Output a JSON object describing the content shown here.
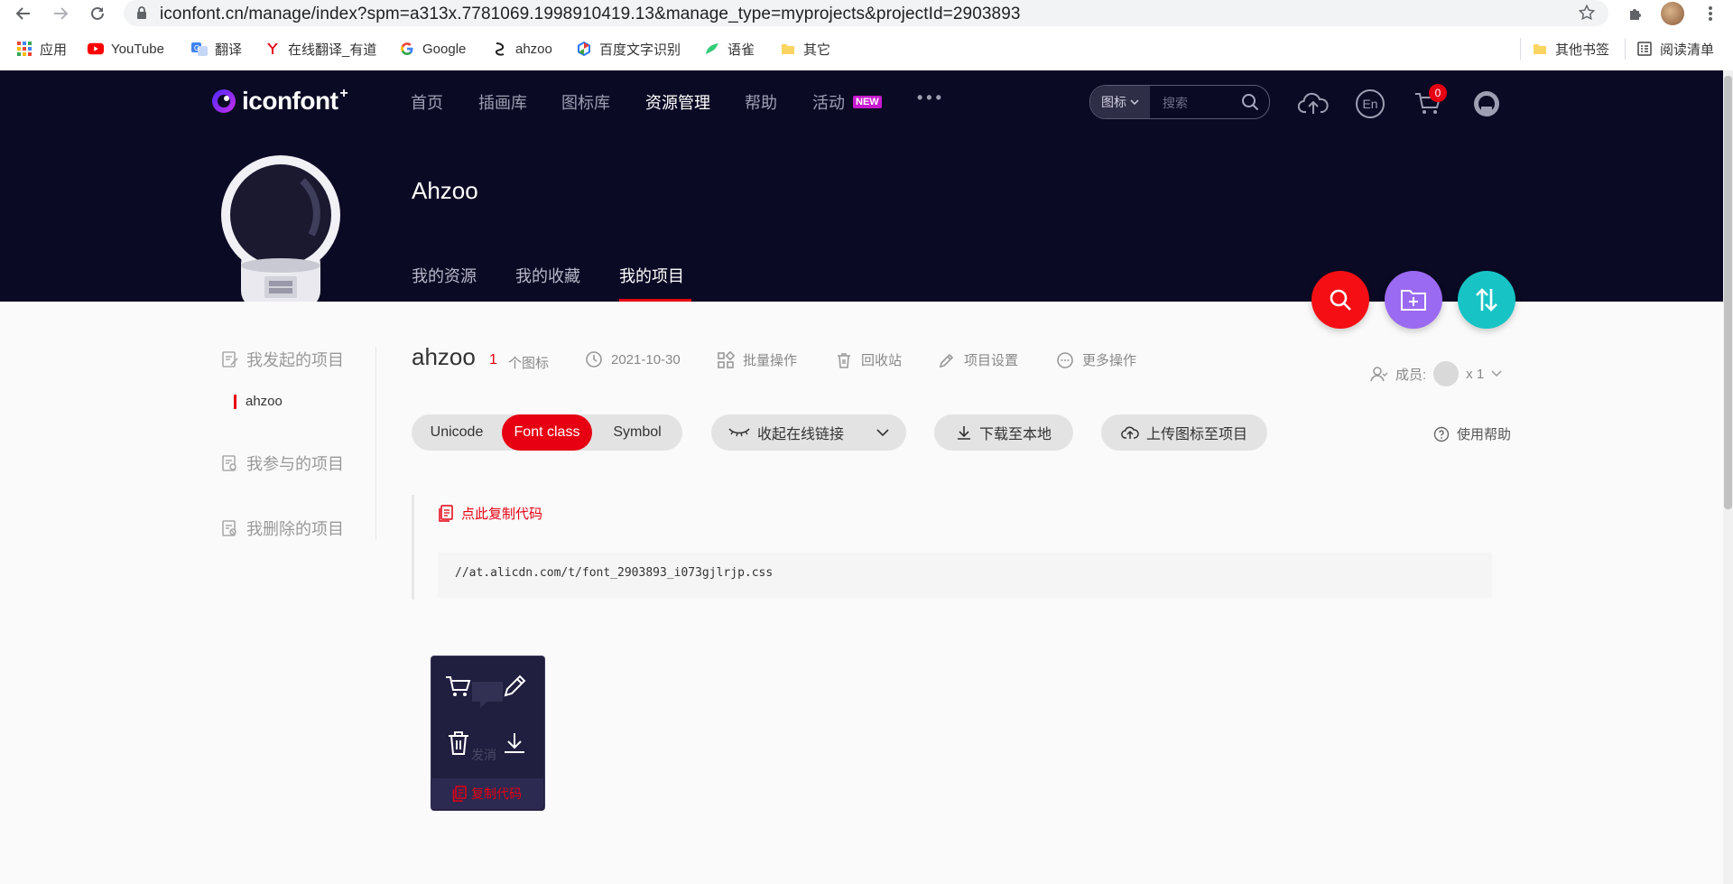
{
  "browser": {
    "url": "iconfont.cn/manage/index?spm=a313x.7781069.1998910419.13&manage_type=myprojects&projectId=2903893",
    "bookmarks": [
      {
        "label": "应用",
        "icon": "apps-grid-icon"
      },
      {
        "label": "YouTube",
        "icon": "youtube-icon"
      },
      {
        "label": "翻译",
        "icon": "translate-icon"
      },
      {
        "label": "在线翻译_有道",
        "icon": "youdao-icon"
      },
      {
        "label": "Google",
        "icon": "google-icon"
      },
      {
        "label": "ahzoo",
        "icon": "ahzoo-icon"
      },
      {
        "label": "百度文字识别",
        "icon": "baidu-ocr-icon"
      },
      {
        "label": "语雀",
        "icon": "yuque-icon"
      },
      {
        "label": "其它",
        "icon": "folder-icon"
      }
    ],
    "other_bookmarks": "其他书签",
    "reading_list": "阅读清单"
  },
  "header": {
    "logo_text": "iconfont",
    "logo_plus": "+",
    "nav": [
      "首页",
      "插画库",
      "图标库",
      "资源管理",
      "帮助",
      "活动"
    ],
    "new_badge": "NEW",
    "more": "•••",
    "search_type": "图标",
    "search_placeholder": "搜索",
    "lang_icon": "En",
    "cart_count": "0"
  },
  "profile": {
    "name": "Ahzoo",
    "tabs": [
      "我的资源",
      "我的收藏",
      "我的项目"
    ]
  },
  "sidebar": {
    "started": "我发起的项目",
    "project_item": "ahzoo",
    "joined": "我参与的项目",
    "deleted": "我删除的项目"
  },
  "project": {
    "name": "ahzoo",
    "icon_count": "1",
    "icon_count_label": "个图标",
    "date": "2021-10-30",
    "batch": "批量操作",
    "trash": "回收站",
    "settings": "项目设置",
    "more": "更多操作",
    "members_label": "成员:",
    "members_count": "x 1"
  },
  "toolbar": {
    "seg_options": [
      "Unicode",
      "Font class",
      "Symbol"
    ],
    "seg_active": "Font class",
    "collapse_link": "收起在线链接",
    "download": "下载至本地",
    "upload": "上传图标至项目",
    "help": "使用帮助"
  },
  "code": {
    "copy_label": "点此复制代码",
    "css_url": "//at.alicdn.com/t/font_2903893_i073gjlrjp.css"
  },
  "icon_card": {
    "name": "发消",
    "copy_label": "复制代码"
  },
  "colors": {
    "brand_red": "#e60012",
    "header_bg": "#0b0a24",
    "fab_search": "#f50f14",
    "fab_folder": "#9b6af2",
    "fab_sort": "#17c3c5",
    "card_bg": "#211f3f"
  }
}
